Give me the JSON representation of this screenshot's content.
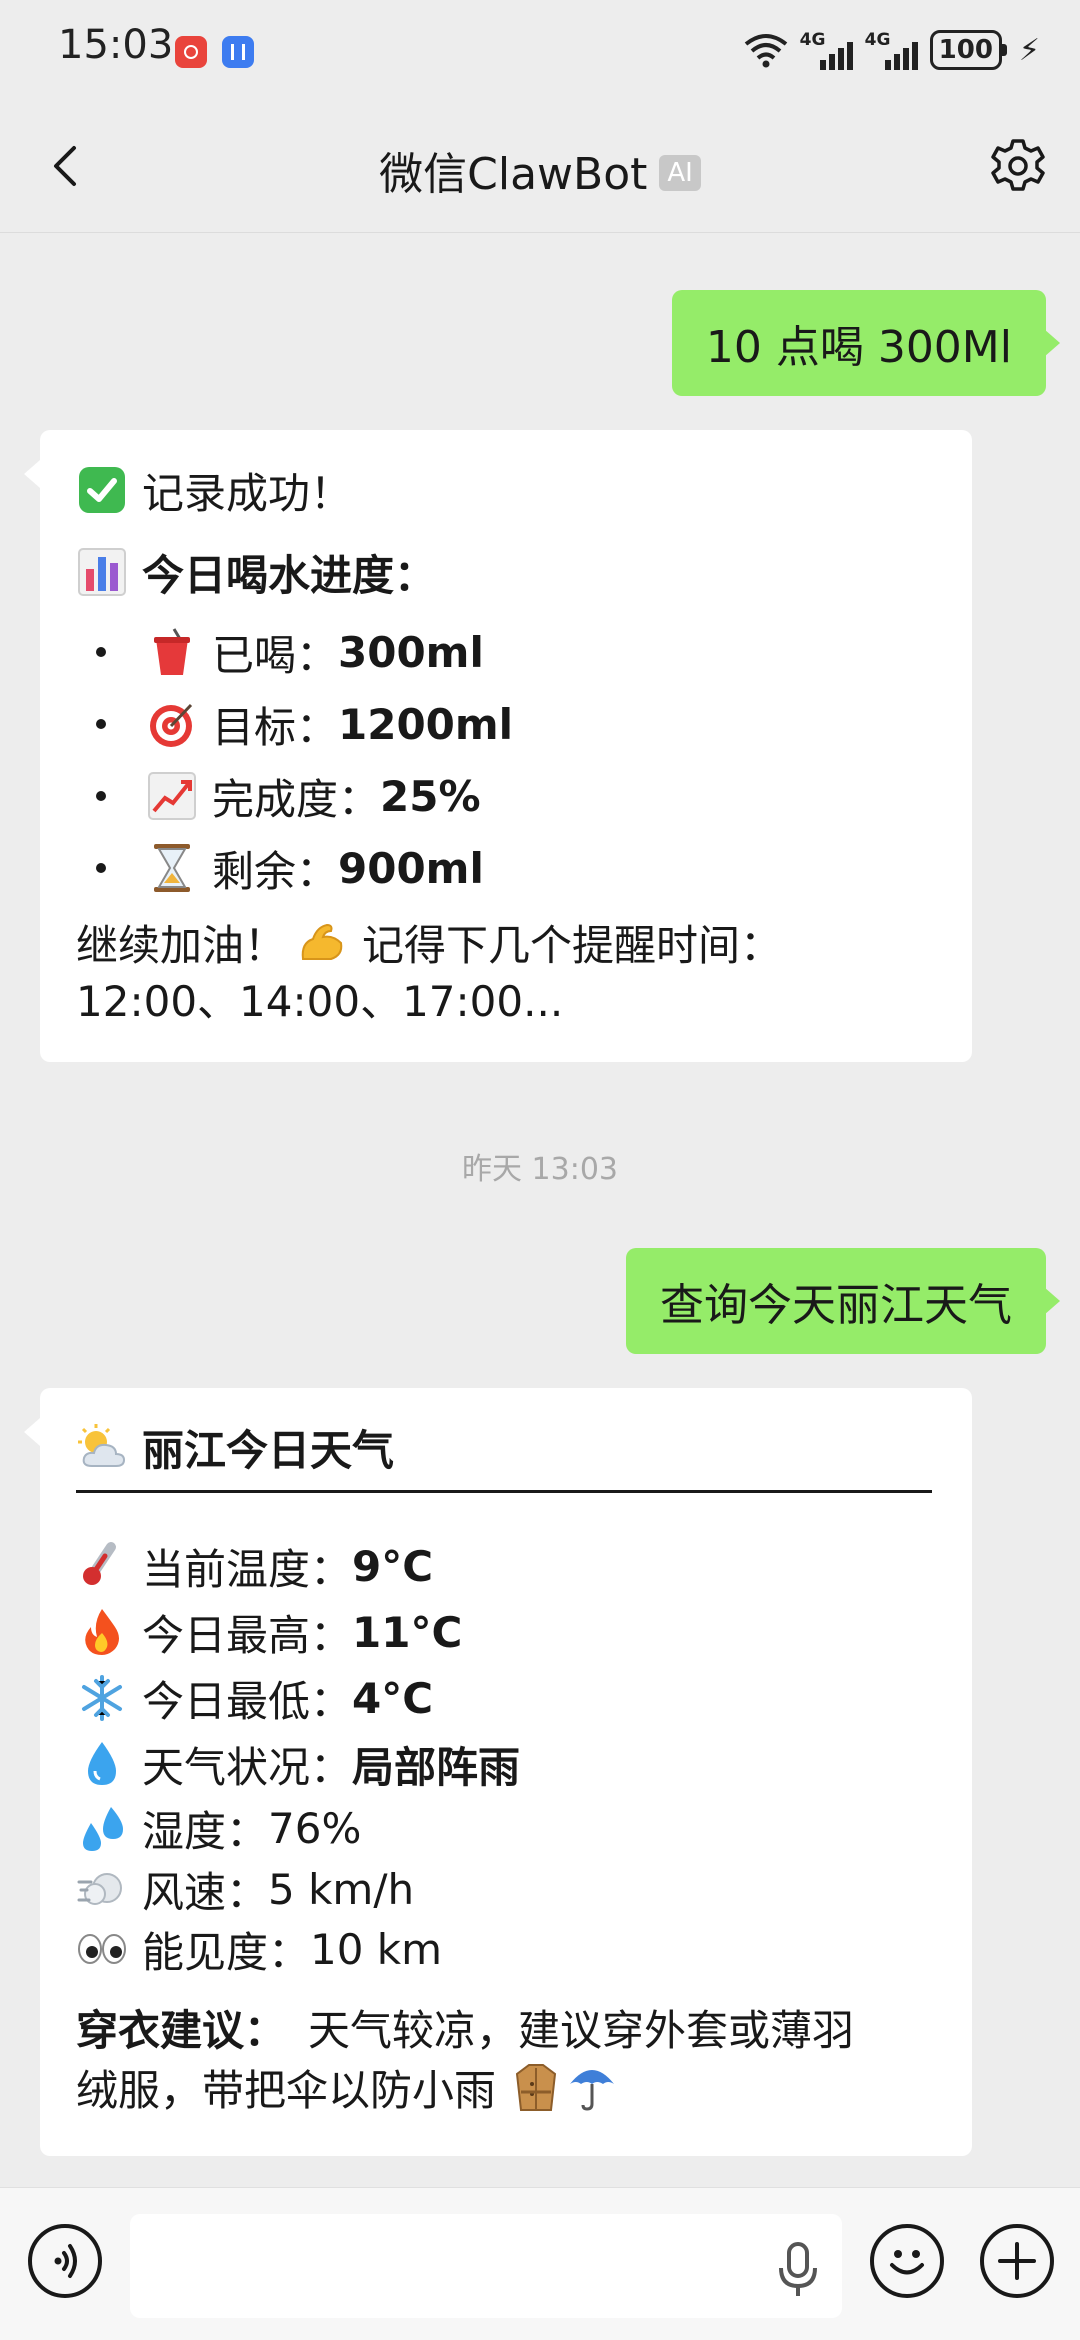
{
  "status_bar": {
    "time": "15:03",
    "network1": "4G",
    "network2": "4G",
    "battery": "100"
  },
  "nav": {
    "title": "微信ClawBot",
    "badge": "AI"
  },
  "messages": {
    "user1": "10 点喝 300Ml",
    "bot1": {
      "success": "记录成功！",
      "progress_title": "今日喝水进度：",
      "items": [
        {
          "label": "已喝：",
          "value": "300ml"
        },
        {
          "label": "目标：",
          "value": "1200ml"
        },
        {
          "label": "完成度：",
          "value": "25%"
        },
        {
          "label": "剩余：",
          "value": "900ml"
        }
      ],
      "footer1": "继续加油！",
      "footer2": "记得下几个提醒时间：",
      "footer3": "12:00、14:00、17:00..."
    },
    "timestamp": "昨天 13:03",
    "user2": "查询今天丽江天气",
    "bot2": {
      "title": "丽江今日天气",
      "rows": [
        {
          "label": "当前温度：",
          "value": "9°C"
        },
        {
          "label": "今日最高：",
          "value": "11°C"
        },
        {
          "label": "今日最低：",
          "value": "4°C"
        },
        {
          "label": "天气状况：",
          "value": "局部阵雨"
        },
        {
          "label": "湿度：",
          "value": "76%"
        },
        {
          "label": "风速：",
          "value": "5 km/h"
        },
        {
          "label": "能见度：",
          "value": "10 km"
        }
      ],
      "advice_label": "穿衣建议：",
      "advice_line1": "天气较凉，建议穿外套或薄羽",
      "advice_line2": "绒服，带把伞以防小雨"
    }
  },
  "icons": {
    "check": "check-icon",
    "chart": "bar-chart-icon",
    "cup": "cup-icon",
    "target": "target-icon",
    "trend": "trend-up-icon",
    "hourglass": "hourglass-icon",
    "muscle": "muscle-icon",
    "sun_cloud": "sun-cloud-icon",
    "thermometer": "thermometer-icon",
    "fire": "fire-icon",
    "snowflake": "snowflake-icon",
    "droplet": "droplet-icon",
    "sweat": "sweat-drops-icon",
    "wind": "wind-icon",
    "eyes": "eyes-icon",
    "coat": "coat-icon",
    "umbrella": "umbrella-icon"
  },
  "colors": {
    "user_bubble": "#95ec69",
    "bot_bubble": "#ffffff",
    "background": "#ededed"
  }
}
